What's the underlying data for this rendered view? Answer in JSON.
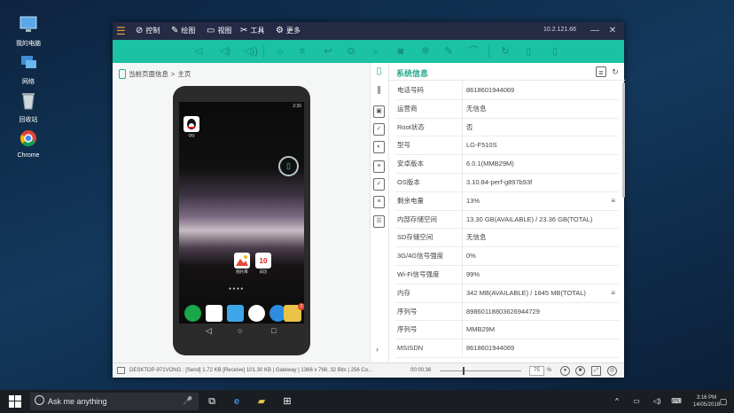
{
  "desktop": {
    "icons": [
      {
        "label": "我的电脑",
        "icon": "computer-icon"
      },
      {
        "label": "网络",
        "icon": "network-icon"
      },
      {
        "label": "回收站",
        "icon": "recycle-bin-icon"
      },
      {
        "label": "Chrome",
        "icon": "chrome-icon"
      }
    ]
  },
  "window": {
    "title_menu": [
      {
        "label": "控制",
        "icon": "control-icon"
      },
      {
        "label": "绘图",
        "icon": "paint-icon"
      },
      {
        "label": "视图",
        "icon": "view-icon"
      },
      {
        "label": "工具",
        "icon": "tools-icon"
      },
      {
        "label": "更多",
        "icon": "more-icon"
      }
    ],
    "ip": "10.2.121.66",
    "breadcrumb": {
      "current": "当前页面信息",
      "sep": ">",
      "page": "主页"
    },
    "phone": {
      "time": "2:30",
      "apps": [
        {
          "label": "QQ"
        },
        {
          "label": "图片库"
        },
        {
          "label": "日历",
          "date": "10"
        }
      ],
      "badge": "2"
    },
    "panel_title": "系统信息",
    "info": [
      {
        "key": "电话号码",
        "value": "8618601944069"
      },
      {
        "key": "运营商",
        "value": "无信息"
      },
      {
        "key": "Root状态",
        "value": "否"
      },
      {
        "key": "型号",
        "value": "LG-F510S"
      },
      {
        "key": "安卓版本",
        "value": "6.0.1(MMB29M)"
      },
      {
        "key": "OS版本",
        "value": "3.10.84-perf-g897b93f"
      },
      {
        "key": "剩余电量",
        "value": "13%",
        "menu": true
      },
      {
        "key": "内部存储空间",
        "value": "13.30 GB(AVAILABLE) / 23.36 GB(TOTAL)"
      },
      {
        "key": "SD存储空间",
        "value": "无信息"
      },
      {
        "key": "3G/4G信号强度",
        "value": "0%"
      },
      {
        "key": "Wi-Fi信号强度",
        "value": "99%"
      },
      {
        "key": "内存",
        "value": "342 MB(AVAILABLE) / 1845 MB(TOTAL)",
        "menu": true
      },
      {
        "key": "序列号",
        "value": "89860118803626944729"
      },
      {
        "key": "序列号",
        "value": "MMB29M"
      },
      {
        "key": "MSISDN",
        "value": "8618601944069"
      }
    ],
    "status": {
      "connection": "DESKTOP-971VONG : [Send] 1.72 KB   [Receive] 101.30 KB | Gateway | 1366 x 768, 32 Bits | 256 Co...",
      "elapsed": "00:00:36",
      "zoom": "75",
      "zoom_unit": "%"
    }
  },
  "taskbar": {
    "search_placeholder": "Ask me anything",
    "time": "3:16 PM",
    "date": "14/05/2018"
  }
}
